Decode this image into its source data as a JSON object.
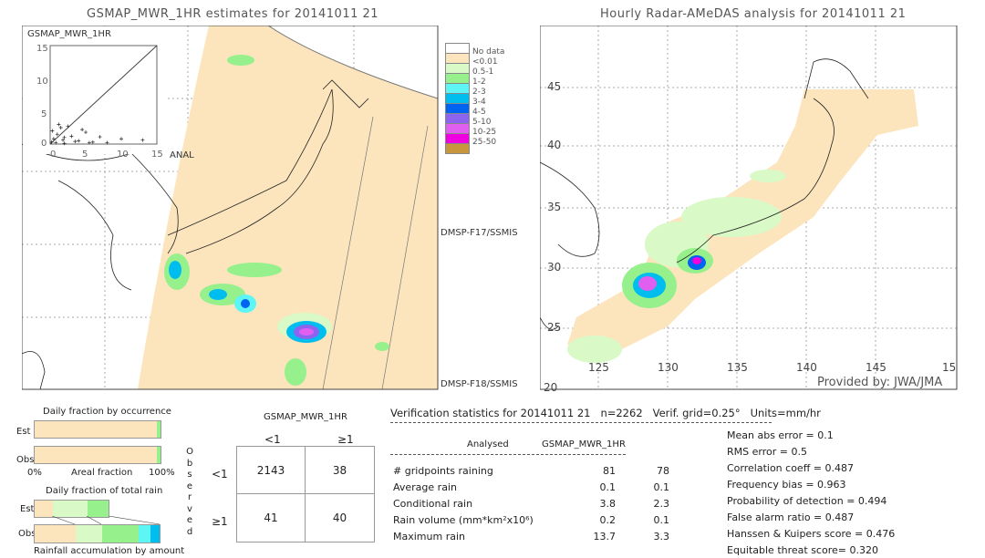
{
  "left_map": {
    "title": "GSMAP_MWR_1HR estimates for 20141011 21",
    "inset_label": "GSMAP_MWR_1HR",
    "inset_xlabel": "ANAL",
    "inset_ticks": [
      "0",
      "5",
      "10",
      "15"
    ],
    "sat1": "DMSP-F17/SSMIS",
    "sat2": "DMSP-F18/SSMIS"
  },
  "right_map": {
    "title": "Hourly Radar-AMeDAS analysis for 20141011 21",
    "lat_ticks": [
      "45",
      "40",
      "35",
      "30",
      "25",
      "20"
    ],
    "lon_ticks": [
      "125",
      "130",
      "135",
      "140",
      "145",
      "15"
    ],
    "credit": "Provided by: JWA/JMA"
  },
  "legend": [
    {
      "label": "",
      "color": "#ffffff"
    },
    {
      "label": "No data",
      "color": "#fce5bd"
    },
    {
      "label": "<0.01",
      "color": "#d9f9c6"
    },
    {
      "label": "0.5-1",
      "color": "#96f08c"
    },
    {
      "label": "1-2",
      "color": "#5ef5f5"
    },
    {
      "label": "2-3",
      "color": "#00bdf0"
    },
    {
      "label": "3-4",
      "color": "#0064f0"
    },
    {
      "label": "4-5",
      "color": "#8c64f0"
    },
    {
      "label": "5-10",
      "color": "#e05ef0"
    },
    {
      "label": "10-25",
      "color": "#f000e0"
    },
    {
      "label": "25-50",
      "color": "#c8963c"
    }
  ],
  "occurrence": {
    "title": "Daily fraction by occurrence",
    "est": "Est",
    "obs": "Obs",
    "x0": "0%",
    "xlabel": "Areal fraction",
    "x1": "100%"
  },
  "total_rain": {
    "title": "Daily fraction of total rain",
    "est": "Est",
    "obs": "Obs",
    "footer": "Rainfall accumulation by amount"
  },
  "contingency": {
    "title": "GSMAP_MWR_1HR",
    "col_lt": "<1",
    "col_ge": "≥1",
    "row_lt": "<1",
    "row_ge": "≥1",
    "side": [
      "O",
      "b",
      "s",
      "e",
      "r",
      "v",
      "e",
      "d"
    ],
    "cells": [
      [
        "2143",
        "38"
      ],
      [
        "41",
        "40"
      ]
    ]
  },
  "stats": {
    "header": "Verification statistics for 20141011 21   n=2262   Verif. grid=0.25°   Units=mm/hr",
    "col1": "Analysed",
    "col2": "GSMAP_MWR_1HR",
    "rows": [
      {
        "label": "# gridpoints raining",
        "a": "81",
        "b": "78"
      },
      {
        "label": "Average rain",
        "a": "0.1",
        "b": "0.1"
      },
      {
        "label": "Conditional rain",
        "a": "3.8",
        "b": "2.3"
      },
      {
        "label": "Rain volume (mm*km²x10⁶)",
        "a": "0.2",
        "b": "0.1"
      },
      {
        "label": "Maximum rain",
        "a": "13.7",
        "b": "3.3"
      }
    ],
    "scores": [
      "Mean abs error = 0.1",
      "RMS error = 0.5",
      "Correlation coeff = 0.487",
      "Frequency bias = 0.963",
      "Probability of detection = 0.494",
      "False alarm ratio = 0.487",
      "Hanssen & Kuipers score = 0.476",
      "Equitable threat score= 0.320"
    ]
  },
  "chart_data": {
    "type": "scatter",
    "xlabel": "ANAL",
    "ylabel": "GSMAP_MWR_1HR",
    "xlim": [
      0,
      15
    ],
    "ylim": [
      0,
      15
    ],
    "points": [
      [
        0.2,
        0.3
      ],
      [
        0.5,
        0.8
      ],
      [
        1,
        1.5
      ],
      [
        1.5,
        2.5
      ],
      [
        0.8,
        0.2
      ],
      [
        2,
        1
      ],
      [
        3,
        1.2
      ],
      [
        4,
        0.5
      ],
      [
        5,
        1.8
      ],
      [
        6,
        0.3
      ],
      [
        8,
        0.2
      ],
      [
        10,
        0.8
      ],
      [
        13,
        0.6
      ],
      [
        2.5,
        2.7
      ],
      [
        1.2,
        3
      ],
      [
        0.3,
        2
      ],
      [
        3.5,
        0.4
      ],
      [
        4.5,
        2.2
      ],
      [
        5.5,
        0.2
      ],
      [
        2,
        0.1
      ],
      [
        7,
        1.1
      ],
      [
        1.8,
        0.6
      ]
    ]
  }
}
